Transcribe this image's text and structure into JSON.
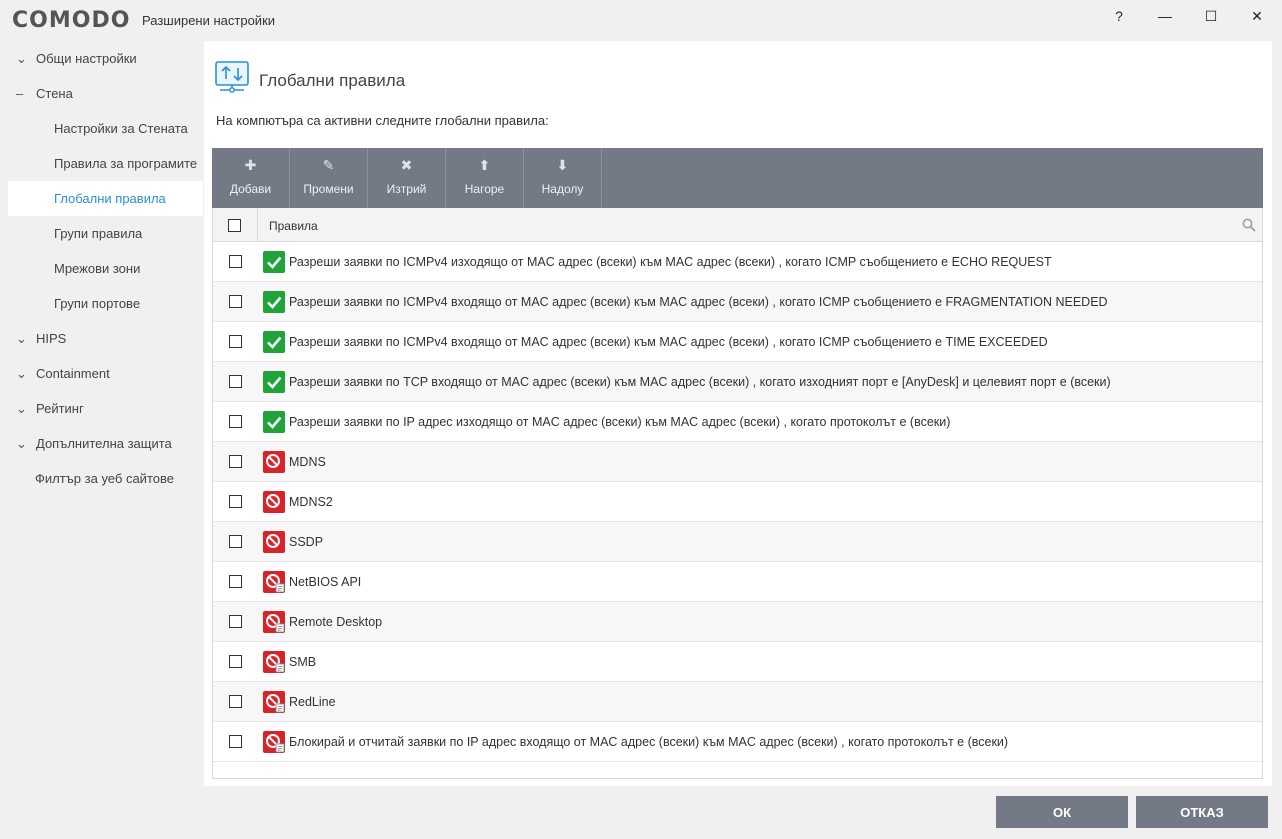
{
  "app": {
    "logo": "COMODO",
    "window_title": "Разширени настройки",
    "help": "?",
    "minimize": "—",
    "maximize": "☐",
    "close": "✕"
  },
  "sidebar": {
    "items": [
      {
        "label": "Общи настройки",
        "expander": "⌄"
      },
      {
        "label": "Стена",
        "expander": "–"
      },
      {
        "label": "Настройки за Стената"
      },
      {
        "label": "Правила за програмите"
      },
      {
        "label": "Глобални правила"
      },
      {
        "label": "Групи правила"
      },
      {
        "label": "Мрежови зони"
      },
      {
        "label": "Групи портове"
      },
      {
        "label": "HIPS",
        "expander": "⌄"
      },
      {
        "label": "Containment",
        "expander": "⌄"
      },
      {
        "label": "Рейтинг",
        "expander": "⌄"
      },
      {
        "label": "Допълнителна защита",
        "expander": "⌄"
      },
      {
        "label": "Филтър за уеб сайтове"
      }
    ]
  },
  "main": {
    "title": "Глобални правила",
    "subtitle": "На компютъра са активни следните глобални правила:",
    "toolbar": {
      "add": {
        "label": "Добави",
        "icon": "✚"
      },
      "edit": {
        "label": "Промени",
        "icon": "✎"
      },
      "delete": {
        "label": "Изтрий",
        "icon": "✖"
      },
      "up": {
        "label": "Нагоре",
        "icon": "⬆"
      },
      "down": {
        "label": "Надолу",
        "icon": "⬇"
      }
    },
    "table": {
      "column": "Правила",
      "rows": [
        {
          "text": "Разреши заявки по ICMPv4 изходящо от MAC адрес (всеки) към MAC адрес (всеки) , когато ICMP съобщението е ECHO REQUEST",
          "status": "allow"
        },
        {
          "text": "Разреши заявки по ICMPv4 входящо от MAC адрес (всеки) към MAC адрес (всеки) , когато ICMP съобщението е FRAGMENTATION NEEDED",
          "status": "allow"
        },
        {
          "text": "Разреши заявки по ICMPv4 входящо от MAC адрес (всеки) към MAC адрес (всеки) , когато ICMP съобщението е TIME EXCEEDED",
          "status": "allow"
        },
        {
          "text": "Разреши заявки по TCP входящо от MAC адрес (всеки) към MAC адрес (всеки) , когато изходният порт е [AnyDesk] и целевият порт е (всеки)",
          "status": "allow"
        },
        {
          "text": "Разреши заявки по IP адрес изходящо от MAC адрес (всеки) към MAC адрес (всеки) , когато протоколът е (всеки)",
          "status": "allow"
        },
        {
          "text": "MDNS",
          "status": "block"
        },
        {
          "text": "MDNS2",
          "status": "block"
        },
        {
          "text": "SSDP",
          "status": "block"
        },
        {
          "text": "NetBIOS API",
          "status": "block-log"
        },
        {
          "text": "Remote Desktop",
          "status": "block-log"
        },
        {
          "text": "SMB",
          "status": "block-log"
        },
        {
          "text": "RedLine",
          "status": "block-log"
        },
        {
          "text": "Блокирай и отчитай заявки по IP адрес входящо от MAC адрес (всеки) към MAC адрес (всеки) , когато протоколът е (всеки)",
          "status": "block-log"
        }
      ]
    }
  },
  "footer": {
    "ok": "ОК",
    "cancel": "ОТКАЗ"
  },
  "colors": {
    "accent": "#2a8fd8",
    "toolbar": "#737a86",
    "allow": "#1fa33a",
    "block": "#d8232a"
  }
}
